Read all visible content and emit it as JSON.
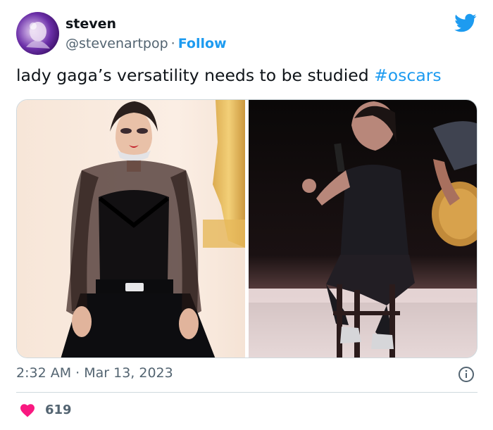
{
  "tweet": {
    "author": {
      "display_name": "steven",
      "handle": "@stevenartpop",
      "separator": "·",
      "follow_label": "Follow"
    },
    "text": "lady gaga’s versatility needs to be studied ",
    "hashtag": "#oscars",
    "timestamp": "2:32 AM · Mar 13, 2023",
    "likes": "619",
    "icons": {
      "brand": "twitter-bird-icon",
      "info": "info-icon",
      "like": "heart-icon"
    },
    "colors": {
      "accent": "#1d9bf0",
      "like": "#f91880",
      "secondary_text": "#536471"
    }
  }
}
